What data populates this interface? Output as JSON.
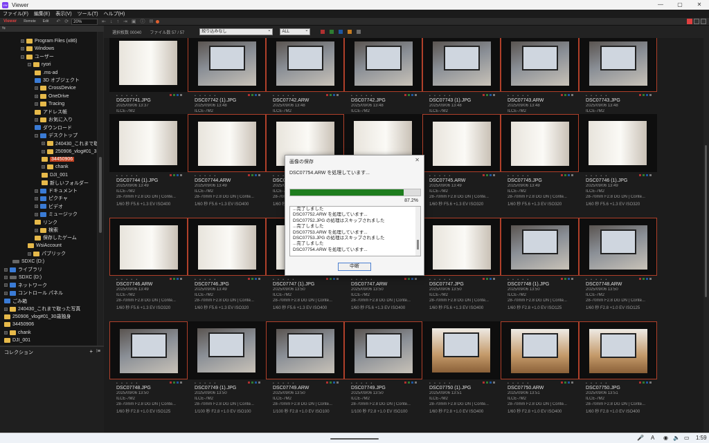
{
  "window": {
    "title": "Viewer",
    "logo": "VW",
    "min": "—",
    "max": "▢",
    "close": "✕"
  },
  "menu": [
    "ファイル(F)",
    "編集(E)",
    "表示(V)",
    "ツール(T)",
    "ヘルプ(H)"
  ],
  "toolbar": {
    "tabs": [
      "Viewer",
      "Remote",
      "Edit"
    ],
    "zoom": "20%"
  },
  "filter": {
    "selected_count": "選択枚数 00040",
    "file_count": "ファイル数 57 / 57",
    "filter_select": "絞り込みなし",
    "type_select": "ALL",
    "swatches": [
      "#b03030",
      "#2e7d32",
      "#1e56a0",
      "#c77c20",
      "#6b6b6b"
    ]
  },
  "sidebar": {
    "header": "⇆",
    "collection_title": "コレクション",
    "collection_add": "+",
    "collection_menu": "⁝≡",
    "tree": [
      {
        "label": "Program Files (x86)",
        "x": 30,
        "y": 1,
        "icon": "folder",
        "exp": "+"
      },
      {
        "label": "Windows",
        "x": 30,
        "y": 2,
        "icon": "folder",
        "exp": "+"
      },
      {
        "label": "ユーザー",
        "x": 30,
        "y": 3,
        "icon": "folder",
        "exp": "-"
      },
      {
        "label": "ryori",
        "x": 40,
        "y": 4,
        "icon": "folder",
        "exp": "-"
      },
      {
        "label": ".ms-ad",
        "x": 50,
        "y": 5,
        "icon": "folder",
        "exp": ""
      },
      {
        "label": "3D オブジェクト",
        "x": 50,
        "y": 6,
        "icon": "blue",
        "exp": ""
      },
      {
        "label": "CrossDevice",
        "x": 50,
        "y": 7,
        "icon": "folder",
        "exp": "+"
      },
      {
        "label": "OneDrive",
        "x": 50,
        "y": 8,
        "icon": "folder",
        "exp": "+"
      },
      {
        "label": "Tracing",
        "x": 50,
        "y": 9,
        "icon": "folder",
        "exp": "+"
      },
      {
        "label": "アドレス帳",
        "x": 50,
        "y": 10,
        "icon": "folder",
        "exp": ""
      },
      {
        "label": "お気に入り",
        "x": 50,
        "y": 11,
        "icon": "folder",
        "exp": "+"
      },
      {
        "label": "ダウンロード",
        "x": 50,
        "y": 12,
        "icon": "blue",
        "exp": ""
      },
      {
        "label": "デスクトップ",
        "x": 50,
        "y": 13,
        "icon": "blue",
        "exp": "-"
      },
      {
        "label": "240430_これまで取",
        "x": 60,
        "y": 14,
        "icon": "folder",
        "exp": "+"
      },
      {
        "label": "250906_vlog#01_3",
        "x": 60,
        "y": 15,
        "icon": "folder",
        "exp": "+"
      },
      {
        "label": "34450906",
        "x": 60,
        "y": 16,
        "icon": "folder",
        "exp": "",
        "selected": true
      },
      {
        "label": "chank",
        "x": 60,
        "y": 17,
        "icon": "folder",
        "exp": "+"
      },
      {
        "label": "DJI_001",
        "x": 60,
        "y": 18,
        "icon": "folder",
        "exp": ""
      },
      {
        "label": "新しいフォルダー",
        "x": 60,
        "y": 19,
        "icon": "folder",
        "exp": ""
      },
      {
        "label": "ドキュメント",
        "x": 50,
        "y": 20,
        "icon": "blue",
        "exp": "+"
      },
      {
        "label": "ピクチャ",
        "x": 50,
        "y": 21,
        "icon": "blue",
        "exp": "+"
      },
      {
        "label": "ビデオ",
        "x": 50,
        "y": 22,
        "icon": "blue",
        "exp": "+"
      },
      {
        "label": "ミュージック",
        "x": 50,
        "y": 23,
        "icon": "blue",
        "exp": "+"
      },
      {
        "label": "リンク",
        "x": 50,
        "y": 24,
        "icon": "folder",
        "exp": ""
      },
      {
        "label": "検索",
        "x": 50,
        "y": 25,
        "icon": "folder",
        "exp": "+"
      },
      {
        "label": "保存したゲーム",
        "x": 50,
        "y": 26,
        "icon": "folder",
        "exp": ""
      },
      {
        "label": "WsiAccount",
        "x": 40,
        "y": 27,
        "icon": "folder",
        "exp": ""
      },
      {
        "label": "パブリック",
        "x": 40,
        "y": 28,
        "icon": "folder",
        "exp": "+"
      },
      {
        "label": "SDXC (D:)",
        "x": 18,
        "y": 29,
        "icon": "drive",
        "exp": ""
      },
      {
        "label": "ライブラリ",
        "x": 6,
        "y": 30,
        "icon": "blue",
        "exp": "+"
      },
      {
        "label": "SDXC (D:)",
        "x": 6,
        "y": 31,
        "icon": "drive",
        "exp": "+"
      },
      {
        "label": "ネットワーク",
        "x": 6,
        "y": 32,
        "icon": "blue",
        "exp": "+"
      },
      {
        "label": "コントロール パネル",
        "x": 6,
        "y": 33,
        "icon": "blue",
        "exp": "+"
      },
      {
        "label": "ごみ箱",
        "x": 6,
        "y": 34,
        "icon": "blue",
        "exp": ""
      },
      {
        "label": "240430_これまで取った写真",
        "x": 6,
        "y": 35,
        "icon": "folder",
        "exp": "+"
      },
      {
        "label": "250906_vlog#01_30歳独身",
        "x": 6,
        "y": 36,
        "icon": "folder",
        "exp": ""
      },
      {
        "label": "34450906",
        "x": 6,
        "y": 37,
        "icon": "folder",
        "exp": ""
      },
      {
        "label": "chank",
        "x": 6,
        "y": 38,
        "icon": "folder",
        "exp": "+"
      },
      {
        "label": "DJI_001",
        "x": 6,
        "y": 39,
        "icon": "folder",
        "exp": ""
      },
      {
        "label": "新しいフォルダー",
        "x": 6,
        "y": 40,
        "icon": "folder",
        "exp": "+"
      }
    ]
  },
  "grid": [
    {
      "name": "DSC07741.JPG",
      "date": "2025/09/06 13:37",
      "cam": "ILCE-7M2",
      "lens": "28-70mm F2.8 DG DN | Conte...",
      "exp": "1/60 秒 F5.6 +1.3 EV ISO400",
      "img": "light",
      "sel": false
    },
    {
      "name": "DSC07742 (1).JPG",
      "date": "2025/09/06 13:48",
      "cam": "ILCE-7M2",
      "lens": "28-70mm F2.8 DG DN | Conte...",
      "exp": "1/60 秒 F5.6 +1.3 EV ISO320",
      "img": "screen",
      "sel": true
    },
    {
      "name": "DSC07742.ARW",
      "date": "2025/09/06 13:48",
      "cam": "ILCE-7M2",
      "lens": "28-70mm F2.8 DG DN | Conte...",
      "exp": "1/60 秒 F5.6 +1.3 EV ISO320",
      "img": "screen",
      "sel": true
    },
    {
      "name": "DSC07742.JPG",
      "date": "2025/09/06 13:48",
      "cam": "ILCE-7M2",
      "lens": "28-70mm F2.8 DG DN | Conte...",
      "exp": "1/60 秒 F5.6 +1.3 EV ISO320",
      "img": "screen",
      "sel": true
    },
    {
      "name": "DSC07743 (1).JPG",
      "date": "2025/09/06 13:48",
      "cam": "ILCE-7M2",
      "lens": "28-70mm F2.8 DG DN | Conte...",
      "exp": "1/60 秒 F5.6 +1.3 EV ISO500",
      "img": "screen",
      "sel": true
    },
    {
      "name": "DSC07743.ARW",
      "date": "2025/09/06 13:48",
      "cam": "ILCE-7M2",
      "lens": "28-70mm F2.8 DG DN | Conte...",
      "exp": "1/60 秒 F5.6 +1.3 EV ISO500",
      "img": "screen",
      "sel": true
    },
    {
      "name": "DSC07743.JPG",
      "date": "2025/09/06 13:48",
      "cam": "ILCE-7M2",
      "lens": "28-70mm F2.8 DG DN | Conte...",
      "exp": "1/60 秒 F5.6 +1.3 EV ISO500",
      "img": "screen",
      "sel": true
    },
    {
      "name": "DSC07744 (1).JPG",
      "date": "2025/09/06 13:49",
      "cam": "ILCE-7M2",
      "lens": "28-70mm F2.8 DG DN | Conte...",
      "exp": "1/60 秒 F5.6 +1.3 EV ISO400",
      "img": "light",
      "sel": false
    },
    {
      "name": "DSC07744.ARW",
      "date": "2025/09/06 13:49",
      "cam": "ILCE-7M2",
      "lens": "28-70mm F2.8 DG DN | Conte...",
      "exp": "1/60 秒 F5.6 +1.3 EV ISO400",
      "img": "light",
      "sel": true
    },
    {
      "name": "DSC07",
      "date": "2025/09/",
      "cam": "ILCE-7M",
      "lens": "28-70mm",
      "exp": "1/60 秒",
      "img": "light",
      "sel": true
    },
    {
      "name": "",
      "date": "",
      "cam": "",
      "lens": "",
      "exp": "",
      "img": "light",
      "sel": false
    },
    {
      "name": "DSC07745.ARW",
      "date": "2025/09/06 13:49",
      "cam": "ILCE-7M2",
      "lens": "28-70mm F2.8 DG DN | Conte...",
      "exp": "1/60 秒 F5.6 +1.3 EV ISO320",
      "img": "light",
      "sel": true
    },
    {
      "name": "DSC07745.JPG",
      "date": "2025/09/06 13:49",
      "cam": "ILCE-7M2",
      "lens": "28-70mm F2.8 DG DN | Conte...",
      "exp": "1/60 秒 F5.6 +1.3 EV ISO320",
      "img": "light",
      "sel": true
    },
    {
      "name": "DSC07746 (1).JPG",
      "date": "2025/09/06 13:49",
      "cam": "ILCE-7M2",
      "lens": "28-70mm F2.8 DG DN | Conte...",
      "exp": "1/60 秒 F5.6 +1.3 EV ISO320",
      "img": "light",
      "sel": false
    },
    {
      "name": "DSC07746.ARW",
      "date": "2025/09/06 13:49",
      "cam": "ILCE-7M2",
      "lens": "28-70mm F2.8 DG DN | Conte...",
      "exp": "1/60 秒 F5.6 +1.3 EV ISO320",
      "img": "light",
      "sel": true
    },
    {
      "name": "DSC07746.JPG",
      "date": "2025/09/06 13:49",
      "cam": "ILCE-7M2",
      "lens": "28-70mm F2.8 DG DN | Conte...",
      "exp": "1/60 秒 F5.6 +1.3 EV ISO320",
      "img": "light",
      "sel": true
    },
    {
      "name": "DSC07747 (1).JPG",
      "date": "2025/09/06 13:50",
      "cam": "ILCE-7M2",
      "lens": "28-70mm F2.8 DG DN | Conte...",
      "exp": "1/60 秒 F5.6 +1.3 EV ISO400",
      "img": "light",
      "sel": true
    },
    {
      "name": "DSC07747.ARW",
      "date": "2025/09/06 13:50",
      "cam": "ILCE-7M2",
      "lens": "28-70mm F2.8 DG DN | Conte...",
      "exp": "1/60 秒 F5.6 +1.3 EV ISO400",
      "img": "light",
      "sel": false
    },
    {
      "name": "DSC07747.JPG",
      "date": "2025/09/06 13:50",
      "cam": "ILCE-7M2",
      "lens": "28-70mm F2.8 DG DN | Conte...",
      "exp": "1/60 秒 F5.6 +1.3 EV ISO400",
      "img": "light",
      "sel": true
    },
    {
      "name": "DSC07748 (1).JPG",
      "date": "2025/09/06 13:50",
      "cam": "ILCE-7M2",
      "lens": "28-70mm F2.8 DG DN | Conte...",
      "exp": "1/60 秒 F2.8 +1.0 EV ISO125",
      "img": "screen",
      "sel": true
    },
    {
      "name": "DSC07748.ARW",
      "date": "2025/09/06 13:50",
      "cam": "ILCE-7M2",
      "lens": "28-70mm F2.8 DG DN | Conte...",
      "exp": "1/60 秒 F2.8 +1.0 EV ISO125",
      "img": "screen",
      "sel": true
    },
    {
      "name": "DSC07748.JPG",
      "date": "2025/09/06 13:50",
      "cam": "ILCE-7M2",
      "lens": "28-70mm F2.8 DG DN | Conte...",
      "exp": "1/60 秒 F2.8 +1.0 EV ISO125",
      "img": "screen",
      "sel": true
    },
    {
      "name": "DSC07749 (1).JPG",
      "date": "2025/09/06 13:50",
      "cam": "ILCE-7M2",
      "lens": "28-70mm F2.8 DG DN | Conte...",
      "exp": "1/100 秒 F2.8 +1.0 EV ISO100",
      "img": "screen",
      "sel": false
    },
    {
      "name": "DSC07749.ARW",
      "date": "2025/09/06 13:50",
      "cam": "ILCE-7M2",
      "lens": "28-70mm F2.8 DG DN | Conte...",
      "exp": "1/100 秒 F2.8 +1.0 EV ISO100",
      "img": "screen",
      "sel": true
    },
    {
      "name": "DSC07749.JPG",
      "date": "2025/09/06 13:50",
      "cam": "ILCE-7M2",
      "lens": "28-70mm F2.8 DG DN | Conte...",
      "exp": "1/100 秒 F2.8 +1.0 EV ISO100",
      "img": "screen",
      "sel": true
    },
    {
      "name": "DSC07750 (1).JPG",
      "date": "2025/09/06 13:51",
      "cam": "ILCE-7M2",
      "lens": "28-70mm F2.8 DG DN | Conte...",
      "exp": "1/60 秒 F2.8 +1.0 EV ISO400",
      "img": "wood",
      "sel": false
    },
    {
      "name": "DSC07750.ARW",
      "date": "2025/09/06 13:51",
      "cam": "ILCE-7M2",
      "lens": "28-70mm F2.8 DG DN | Conte...",
      "exp": "1/60 秒 F2.8 +1.0 EV ISO400",
      "img": "wood",
      "sel": true
    },
    {
      "name": "DSC07750.JPG",
      "date": "2025/09/06 13:51",
      "cam": "ILCE-7M2",
      "lens": "28-70mm F2.8 DG DN | Conte...",
      "exp": "1/60 秒 F2.8 +1.0 EV ISO400",
      "img": "wood",
      "sel": true
    }
  ],
  "dialog": {
    "title": "画像の保存",
    "close": "✕",
    "status": "DSC07754.ARW を処理しています...",
    "progress": 0.872,
    "percent": "87.2%",
    "log": [
      "...完了しました",
      "DSC07752.ARW を処理しています...",
      "DSC07752.JPG の処理はスキップされました",
      "...完了しました",
      "DSC07753.ARW を処理しています...",
      "DSC07753.JPG の処理はスキップされました",
      "...完了しました",
      "DSC07754.ARW を処理しています..."
    ],
    "button": "中断"
  },
  "taskbar": {
    "time": "1:59",
    "mic": "🎤",
    "ime": "A",
    "wifi": "◉",
    "volume": "🔈",
    "battery": "▭"
  }
}
